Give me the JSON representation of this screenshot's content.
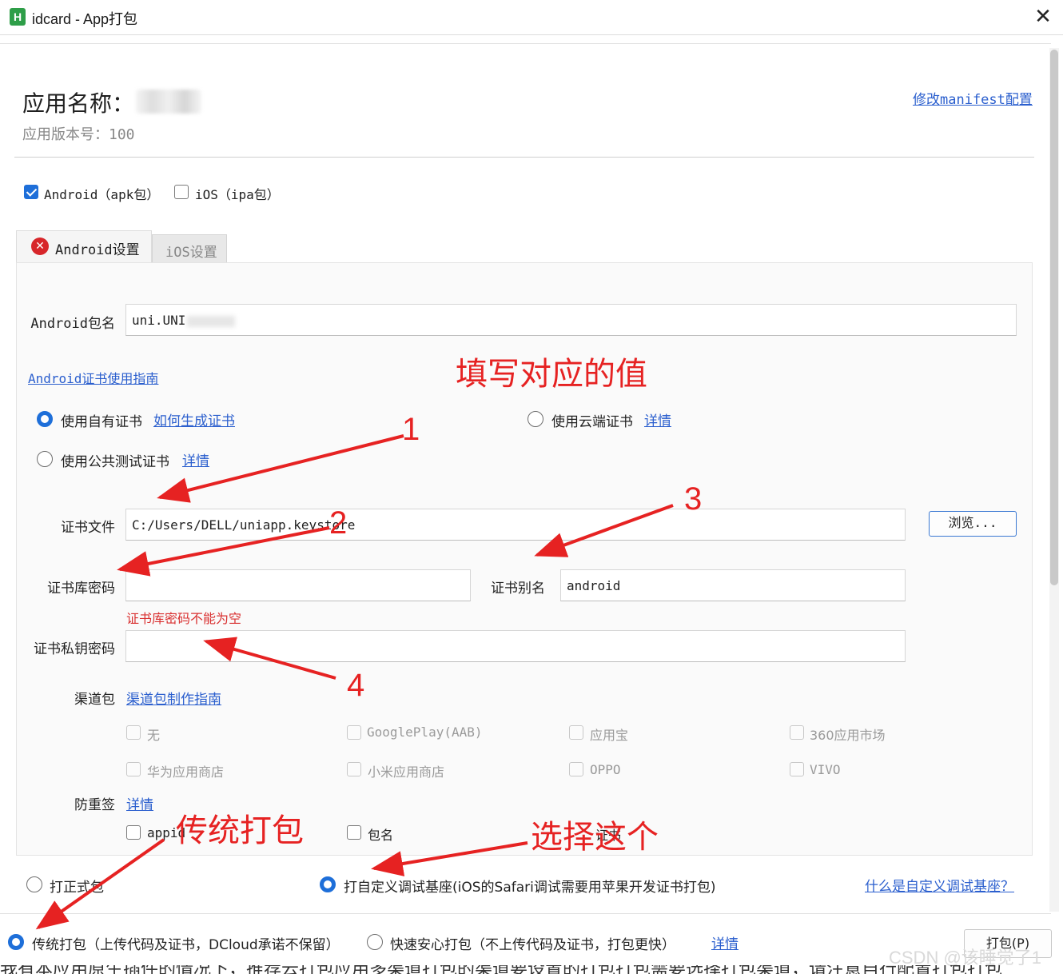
{
  "window": {
    "title": "idcard - App打包",
    "icon_letter": "H",
    "close_glyph": "✕"
  },
  "app": {
    "name_label": "应用名称：",
    "name_value": "",
    "version_text": "应用版本号：100",
    "manifest_link": "修改manifest配置"
  },
  "platforms": {
    "android_label": "Android（apk包）",
    "android_checked": true,
    "ios_label": "iOS（ipa包）",
    "ios_checked": false
  },
  "tabs": {
    "android": "Android设置",
    "ios": "iOS设置",
    "error_glyph": "✕"
  },
  "android_settings": {
    "package_label": "Android包名",
    "package_value": "uni.UNI",
    "cert_guide_link": "Android证书使用指南",
    "cert_own_label": "使用自有证书",
    "cert_own_link": "如何生成证书",
    "cert_own_selected": true,
    "cert_cloud_label": "使用云端证书",
    "cert_cloud_link": "详情",
    "cert_public_label": "使用公共测试证书",
    "cert_public_link": "详情",
    "cert_file_label": "证书文件",
    "cert_file_value": "C:/Users/DELL/uniapp.keystore",
    "browse_label": "浏览...",
    "store_pwd_label": "证书库密码",
    "store_pwd_value": "",
    "store_pwd_error": "证书库密码不能为空",
    "alias_label": "证书别名",
    "alias_value": "android",
    "key_pwd_label": "证书私钥密码",
    "key_pwd_value": ""
  },
  "channels": {
    "label": "渠道包",
    "guide_link": "渠道包制作指南",
    "items": [
      "无",
      "GooglePlay(AAB)",
      "应用宝",
      "360应用市场",
      "华为应用商店",
      "小米应用商店",
      "OPPO",
      "VIVO"
    ]
  },
  "anti_resign": {
    "label": "防重签",
    "link": "详情",
    "items": [
      "appid",
      "包名",
      "证书"
    ]
  },
  "build_type": {
    "formal_label": "打正式包",
    "custom_base_label": "打自定义调试基座(iOS的Safari调试需要用苹果开发证书打包)",
    "custom_base_selected": true,
    "what_link": "什么是自定义调试基座？"
  },
  "pack_mode": {
    "traditional_label": "传统打包（上传代码及证书，DCloud承诺不保留）",
    "traditional_selected": true,
    "fast_label": "快速安心打包（不上传代码及证书，打包更快）",
    "detail_link": "详情",
    "pack_button": "打包(P)"
  },
  "annotations": {
    "fill_values": "填写对应的值",
    "n1": "1",
    "n2": "2",
    "n3": "3",
    "n4": "4",
    "traditional": "传统打包",
    "choose_this": "选择这个",
    "color": "#e62222"
  },
  "watermark": "CSDN @该睡觉了1",
  "bottom_strip": "我有本应用原生插件的情况下，推荐云打包应用多渠道打包的渠道要设置的打包打包需要选择打包渠道，请注意自行配置打包打包"
}
